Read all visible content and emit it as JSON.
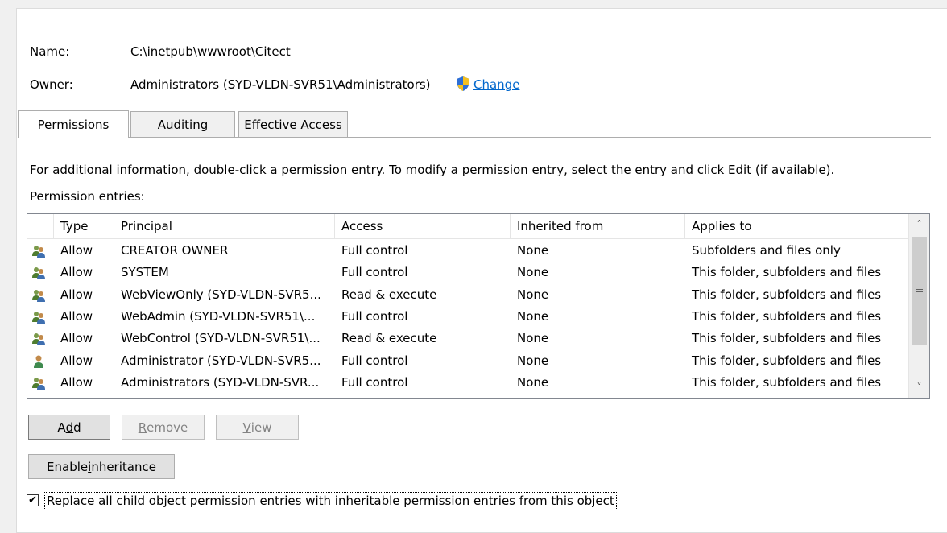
{
  "header": {
    "name_label": "Name:",
    "name_value": "C:\\inetpub\\wwwroot\\Citect",
    "owner_label": "Owner:",
    "owner_value": "Administrators (SYD-VLDN-SVR51\\Administrators)",
    "change_link": "Change"
  },
  "tabs": [
    {
      "label": "Permissions",
      "active": true
    },
    {
      "label": "Auditing",
      "active": false
    },
    {
      "label": "Effective Access",
      "active": false
    }
  ],
  "info_text": "For additional information, double-click a permission entry. To modify a permission entry, select the entry and click Edit (if available).",
  "entries_label": "Permission entries:",
  "table": {
    "columns": [
      "Type",
      "Principal",
      "Access",
      "Inherited from",
      "Applies to"
    ],
    "rows": [
      {
        "icon": "group-users-icon",
        "type": "Allow",
        "principal": "CREATOR OWNER",
        "access": "Full control",
        "inherited": "None",
        "applies": "Subfolders and files only"
      },
      {
        "icon": "group-users-icon",
        "type": "Allow",
        "principal": "SYSTEM",
        "access": "Full control",
        "inherited": "None",
        "applies": "This folder, subfolders and files"
      },
      {
        "icon": "group-users-icon",
        "type": "Allow",
        "principal": "WebViewOnly (SYD-VLDN-SVR5...",
        "access": "Read & execute",
        "inherited": "None",
        "applies": "This folder, subfolders and files"
      },
      {
        "icon": "group-users-icon",
        "type": "Allow",
        "principal": "WebAdmin (SYD-VLDN-SVR51\\...",
        "access": "Full control",
        "inherited": "None",
        "applies": "This folder, subfolders and files"
      },
      {
        "icon": "group-users-icon",
        "type": "Allow",
        "principal": "WebControl (SYD-VLDN-SVR51\\...",
        "access": "Read & execute",
        "inherited": "None",
        "applies": "This folder, subfolders and files"
      },
      {
        "icon": "single-user-icon",
        "type": "Allow",
        "principal": "Administrator (SYD-VLDN-SVR5...",
        "access": "Full control",
        "inherited": "None",
        "applies": "This folder, subfolders and files"
      },
      {
        "icon": "group-users-icon",
        "type": "Allow",
        "principal": "Administrators (SYD-VLDN-SVR...",
        "access": "Full control",
        "inherited": "None",
        "applies": "This folder, subfolders and files"
      }
    ]
  },
  "buttons": {
    "add": {
      "label": "Add",
      "mnemonic_index": 1
    },
    "remove": {
      "label": "Remove",
      "mnemonic_index": 0
    },
    "view": {
      "label": "View",
      "mnemonic_index": 0
    },
    "enable_inheritance": {
      "label": "Enable inheritance",
      "mnemonic_index": 7
    }
  },
  "replace_checkbox": {
    "checked": true,
    "label": "Replace all child object permission entries with inheritable permission entries from this object",
    "mnemonic_index": 0
  },
  "colors": {
    "link": "#0066cc",
    "shield_blue": "#2d6fd6",
    "shield_yellow": "#f4c020"
  }
}
